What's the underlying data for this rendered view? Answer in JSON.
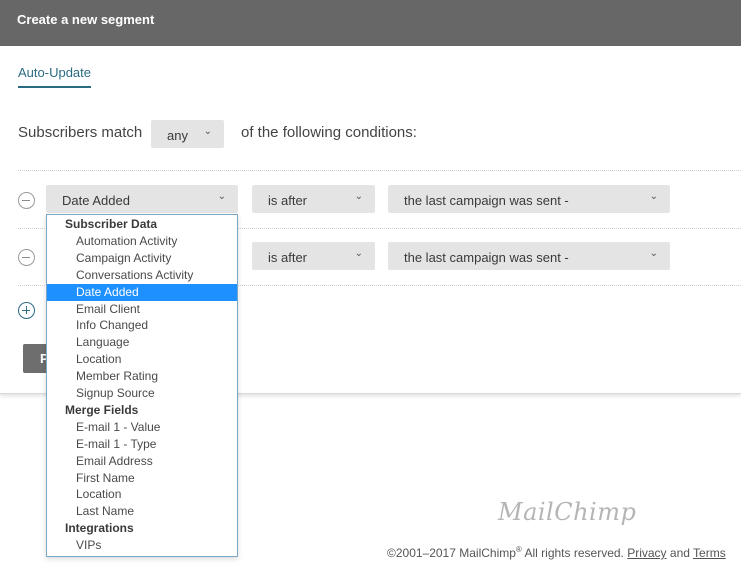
{
  "modal": {
    "title": "Create a new segment",
    "tab_label": "Auto-Update",
    "match_label": "Subscribers match",
    "match_value": "any",
    "match_tail": "of the following conditions:",
    "preview_label": "P"
  },
  "conditions": [
    {
      "field": "Date Added",
      "operator": "is after",
      "value": "the last campaign was sent -"
    },
    {
      "field": "",
      "operator": "is after",
      "value": "the last campaign was sent -"
    }
  ],
  "dropdown": {
    "items": [
      {
        "type": "group",
        "label": "Subscriber Data"
      },
      {
        "type": "opt",
        "label": "Automation Activity"
      },
      {
        "type": "opt",
        "label": "Campaign Activity"
      },
      {
        "type": "opt",
        "label": "Conversations Activity"
      },
      {
        "type": "opt",
        "label": "Date Added",
        "selected": true
      },
      {
        "type": "opt",
        "label": "Email Client"
      },
      {
        "type": "opt",
        "label": "Info Changed"
      },
      {
        "type": "opt",
        "label": "Language"
      },
      {
        "type": "opt",
        "label": "Location"
      },
      {
        "type": "opt",
        "label": "Member Rating"
      },
      {
        "type": "opt",
        "label": "Signup Source"
      },
      {
        "type": "group",
        "label": "Merge Fields"
      },
      {
        "type": "opt",
        "label": "E-mail 1 - Value"
      },
      {
        "type": "opt",
        "label": "E-mail 1 - Type"
      },
      {
        "type": "opt",
        "label": "Email Address"
      },
      {
        "type": "opt",
        "label": "First Name"
      },
      {
        "type": "opt",
        "label": "Location"
      },
      {
        "type": "opt",
        "label": "Last Name"
      },
      {
        "type": "group",
        "label": "Integrations"
      },
      {
        "type": "opt",
        "label": "VIPs"
      }
    ]
  },
  "footer": {
    "logo": "MailChimp",
    "copyright": "©2001–2017 MailChimp",
    "registered": "®",
    "rights": " All rights reserved.",
    "privacy": "Privacy",
    "and": " and ",
    "terms": "Terms"
  },
  "icons": {
    "chevron": "chevron-down-icon",
    "remove": "minus-circle-icon",
    "add": "plus-circle-icon"
  },
  "colors": {
    "header_bg": "#676767",
    "accent": "#2a6b82",
    "selected_bg": "#1e90ff",
    "select_bg": "#e4e4e4"
  }
}
